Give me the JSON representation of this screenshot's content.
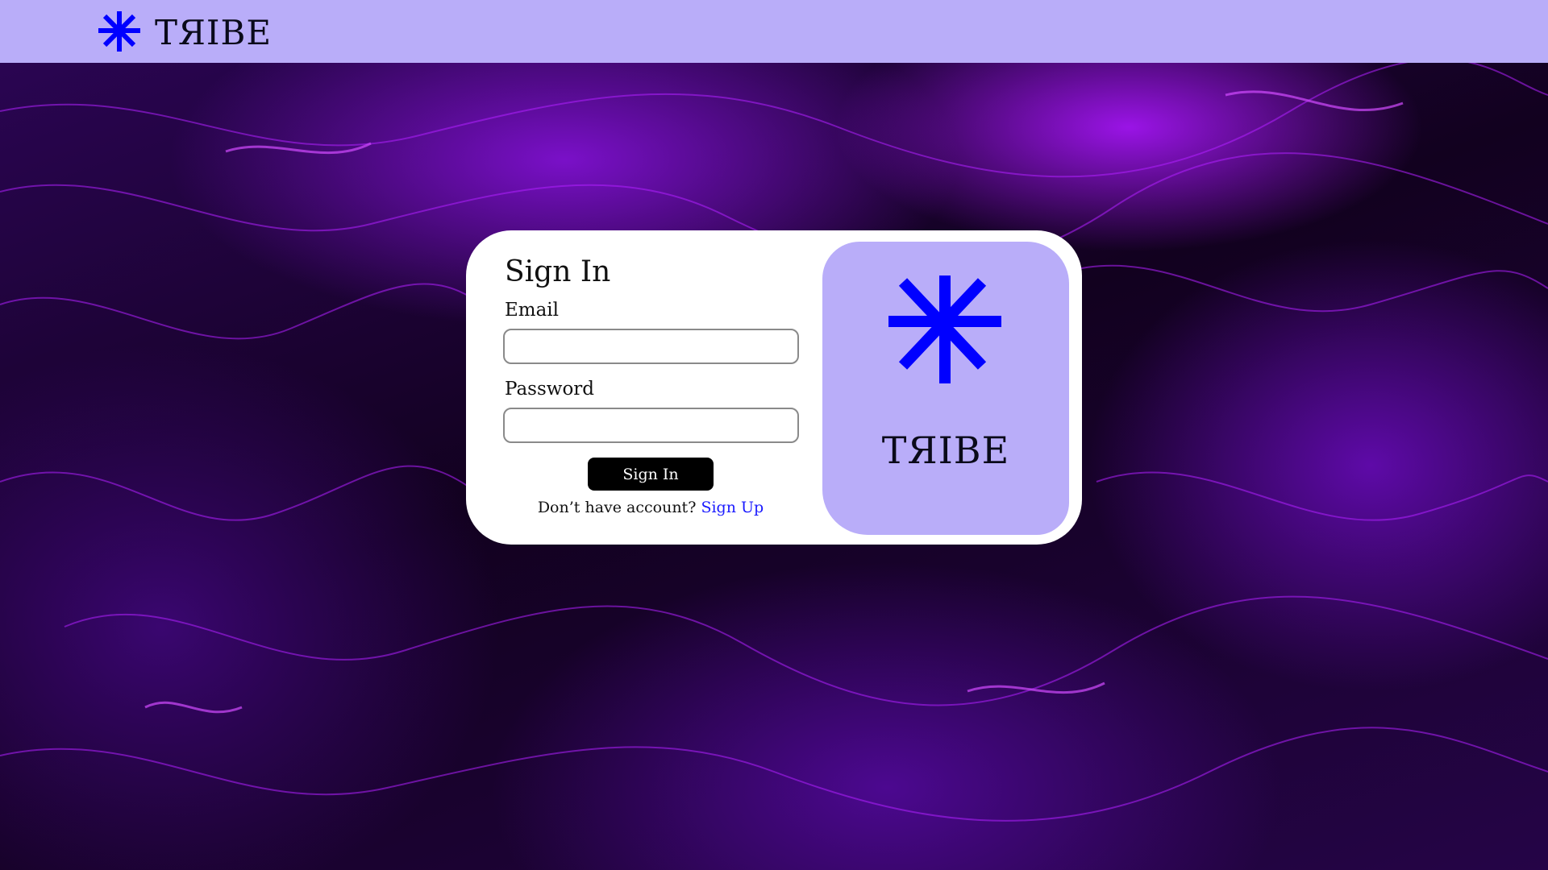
{
  "header": {
    "brand": "TЯIBE",
    "logo_icon": "asterisk-star-icon"
  },
  "signin": {
    "title": "Sign In",
    "email_label": "Email",
    "email_value": "",
    "password_label": "Password",
    "password_value": "",
    "submit_label": "Sign In",
    "signup_prompt": "Don’t have account?",
    "signup_link": "Sign Up"
  },
  "brand_panel": {
    "brand": "TЯIBE",
    "logo_icon": "asterisk-star-icon"
  },
  "colors": {
    "header_bg": "#b9adf9",
    "brand_blue": "#0000ff",
    "link_blue": "#1a1aff",
    "button_bg": "#000000",
    "card_bg": "#ffffff"
  }
}
